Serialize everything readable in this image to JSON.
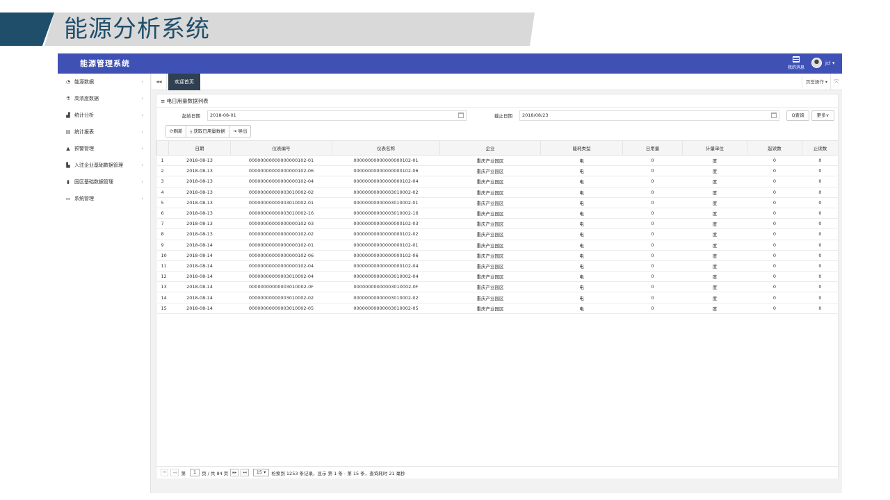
{
  "slide": {
    "title": "能源分析系统"
  },
  "app": {
    "title": "能源管理系统",
    "message_center": "我的消息",
    "user": "jcl ▾"
  },
  "sidebar": {
    "items": [
      {
        "icon": "dashboard-icon",
        "glyph": "◔",
        "label": "能源数据"
      },
      {
        "icon": "flask-icon",
        "glyph": "⚗",
        "label": "高浓度数据"
      },
      {
        "icon": "chart-icon",
        "glyph": "▟",
        "label": "统计分析"
      },
      {
        "icon": "report-icon",
        "glyph": "▤",
        "label": "统计报表"
      },
      {
        "icon": "bell-icon",
        "glyph": "▲",
        "label": "预警管理"
      },
      {
        "icon": "map-icon",
        "glyph": "▙",
        "label": "入驻企业基础数据管理"
      },
      {
        "icon": "book-icon",
        "glyph": "▮",
        "label": "园区基础数据管理"
      },
      {
        "icon": "monitor-icon",
        "glyph": "▭",
        "label": "系统管理"
      }
    ],
    "chevron": "‹"
  },
  "tabs": {
    "back": "◂◂",
    "active": "欢迎首页",
    "page_ops": "页签操作 ▾",
    "fullscreen": "⤧"
  },
  "panel": {
    "title": "≡ 电日用量数据列表",
    "start_label": "起始日期",
    "start_value": "2018-08-01",
    "end_label": "截止日期",
    "end_value": "2018/08/23",
    "query_button": "Q查询",
    "more_button": "更多∨",
    "toolbar": {
      "refresh": "⟳刷新",
      "fetch": "⤓ 获取日用量数据",
      "export": "⇥ 导出"
    }
  },
  "table": {
    "headers": [
      "",
      "日期",
      "仪表编号",
      "仪表名称",
      "企业",
      "能耗类型",
      "日用量",
      "计量单位",
      "起读数",
      "止读数"
    ],
    "rows": [
      [
        "1",
        "2018-08-13",
        "00000000000000000102-01",
        "00000000000000000102-01",
        "重庆产业园区",
        "电",
        "0",
        "度",
        "0",
        "0"
      ],
      [
        "2",
        "2018-08-13",
        "00000000000000000102-06",
        "00000000000000000102-06",
        "重庆产业园区",
        "电",
        "0",
        "度",
        "0",
        "0"
      ],
      [
        "3",
        "2018-08-13",
        "00000000000000000102-04",
        "00000000000000000102-04",
        "重庆产业园区",
        "电",
        "0",
        "度",
        "0",
        "0"
      ],
      [
        "4",
        "2018-08-13",
        "00000000000003010002-02",
        "00000000000003010002-02",
        "重庆产业园区",
        "电",
        "0",
        "度",
        "0",
        "0"
      ],
      [
        "5",
        "2018-08-13",
        "00000000000003010002-01",
        "00000000000003010002-01",
        "重庆产业园区",
        "电",
        "0",
        "度",
        "0",
        "0"
      ],
      [
        "6",
        "2018-08-13",
        "00000000000003010002-16",
        "00000000000003010002-16",
        "重庆产业园区",
        "电",
        "0",
        "度",
        "0",
        "0"
      ],
      [
        "7",
        "2018-08-13",
        "00000000000000000102-03",
        "00000000000000000102-03",
        "重庆产业园区",
        "电",
        "0",
        "度",
        "0",
        "0"
      ],
      [
        "8",
        "2018-08-13",
        "00000000000000000102-02",
        "00000000000000000102-02",
        "重庆产业园区",
        "电",
        "0",
        "度",
        "0",
        "0"
      ],
      [
        "9",
        "2018-08-14",
        "00000000000000000102-01",
        "00000000000000000102-01",
        "重庆产业园区",
        "电",
        "0",
        "度",
        "0",
        "0"
      ],
      [
        "10",
        "2018-08-14",
        "00000000000000000102-06",
        "00000000000000000102-06",
        "重庆产业园区",
        "电",
        "0",
        "度",
        "0",
        "0"
      ],
      [
        "11",
        "2018-08-14",
        "00000000000000000102-04",
        "00000000000000000102-04",
        "重庆产业园区",
        "电",
        "0",
        "度",
        "0",
        "0"
      ],
      [
        "12",
        "2018-08-14",
        "00000000000003010002-04",
        "00000000000003010002-04",
        "重庆产业园区",
        "电",
        "0",
        "度",
        "0",
        "0"
      ],
      [
        "13",
        "2018-08-14",
        "00000000000003010002-0F",
        "00000000000003010002-0F",
        "重庆产业园区",
        "电",
        "0",
        "度",
        "0",
        "0"
      ],
      [
        "14",
        "2018-08-14",
        "00000000000003010002-02",
        "00000000000003010002-02",
        "重庆产业园区",
        "电",
        "0",
        "度",
        "0",
        "0"
      ],
      [
        "15",
        "2018-08-14",
        "00000000000003010002-05",
        "00000000000003010002-05",
        "重庆产业园区",
        "电",
        "0",
        "度",
        "0",
        "0"
      ]
    ]
  },
  "pager": {
    "first": "⏮",
    "prev": "◂◂",
    "page_prefix": "第",
    "page_value": "1",
    "page_suffix": "页 / 共 84 页",
    "next": "▸▸",
    "last": "⏭",
    "page_size": "15 ▾",
    "summary": "检索到 1253 条记录，显示 第 1 条 - 第 15 条，查询耗时 21 毫秒"
  },
  "colors": {
    "topbar": "#3f51b5",
    "banner_dark": "#1f4e6b",
    "banner_light": "#d9d9d9",
    "active_tab": "#2f4050"
  }
}
